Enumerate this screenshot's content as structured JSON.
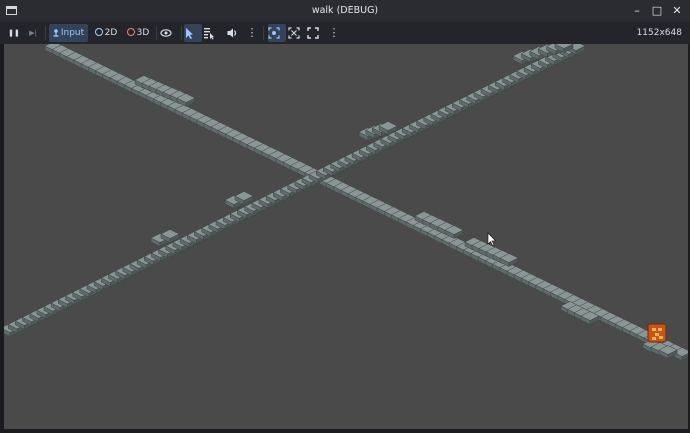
{
  "window": {
    "title": "walk (DEBUG)",
    "minimize_glyph": "–",
    "maximize_glyph": "□",
    "close_glyph": "✕"
  },
  "toolbar": {
    "pause_glyph": "❚❚",
    "step_glyph": "▶|",
    "input_label": "Input",
    "label_2d": "2D",
    "label_3d": "3D",
    "more_glyph": "⋮",
    "resolution": "1152x648"
  },
  "colors": {
    "viewport_bg": "#4a4a4a",
    "tile_top": "#8a9595",
    "tile_side": "#5f6a6a",
    "tile_edge": "#3c4444",
    "accent": "#9fc4ff",
    "icon_2d": "#9fd3ff",
    "icon_3d": "#ff7b7b"
  }
}
